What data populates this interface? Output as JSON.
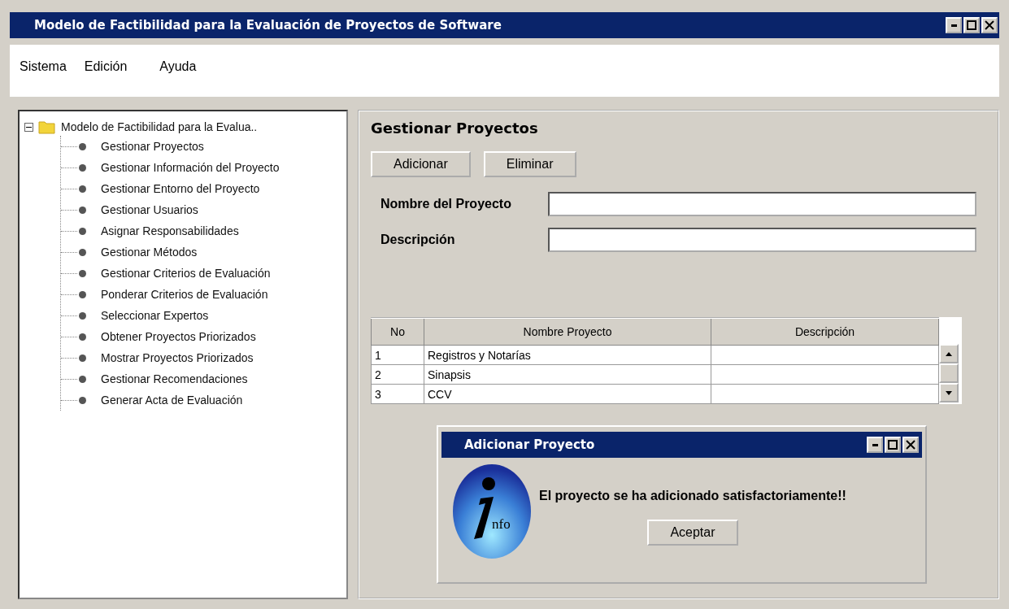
{
  "window": {
    "title": "Modelo de Factibilidad para la Evaluación de Proyectos de Software"
  },
  "menu": [
    "Sistema",
    "Edición",
    "Ayuda"
  ],
  "tree": {
    "label": "Modelo de Factibilidad para la Evalua..",
    "expanded": true,
    "children": [
      {
        "label": "Gestionar Proyectos"
      },
      {
        "label": "Gestionar Información del Proyecto"
      },
      {
        "label": "Gestionar Entorno del Proyecto"
      },
      {
        "label": "Gestionar Usuarios"
      },
      {
        "label": "Asignar Responsabilidades"
      },
      {
        "label": "Gestionar Métodos"
      },
      {
        "label": "Gestionar Criterios de Evaluación"
      },
      {
        "label": "Ponderar Criterios de Evaluación"
      },
      {
        "label": "Seleccionar Expertos"
      },
      {
        "label": "Obtener Proyectos Priorizados"
      },
      {
        "label": "Mostrar Proyectos Priorizados"
      },
      {
        "label": "Gestionar Recomendaciones"
      },
      {
        "label": "Generar Acta de Evaluación"
      }
    ]
  },
  "panel": {
    "title": "Gestionar Proyectos",
    "buttons": [
      "Adicionar",
      "Eliminar"
    ],
    "fields": [
      {
        "label": "Nombre del Proyecto"
      },
      {
        "label": "Descripción"
      }
    ],
    "table": {
      "columns": [
        "No",
        "Nombre Proyecto",
        "Descripción"
      ],
      "rows": [
        [
          "1",
          "Registros y Notarías",
          ""
        ],
        [
          "2",
          "Sinapsis",
          ""
        ],
        [
          "3",
          "CCV",
          ""
        ]
      ]
    }
  },
  "dialog": {
    "title": "Adicionar Proyecto",
    "icon_text": "nfo",
    "message": "El proyecto se ha adicionado satisfactoriamente!!",
    "button": "Aceptar"
  }
}
